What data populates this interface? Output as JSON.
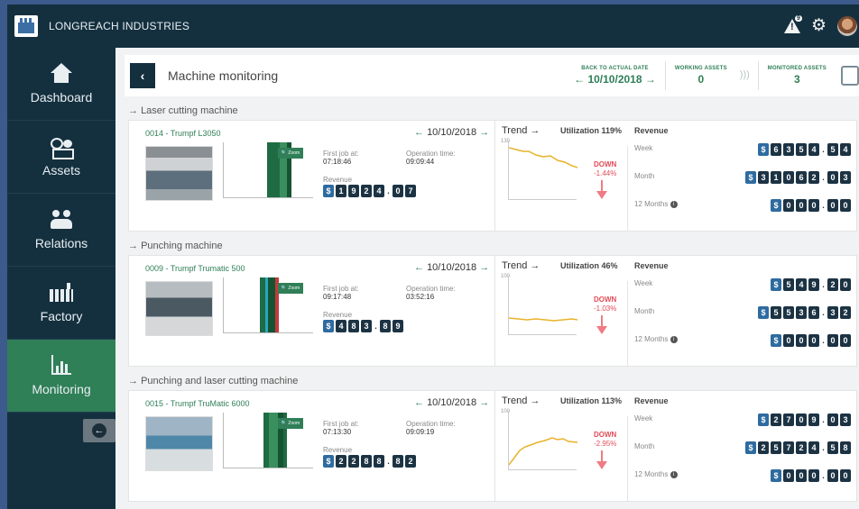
{
  "app": {
    "company": "LONGREACH INDUSTRIES",
    "alert_count": "9"
  },
  "sidebar": {
    "items": [
      {
        "label": "Dashboard",
        "icon": "home-icon"
      },
      {
        "label": "Assets",
        "icon": "assets-icon"
      },
      {
        "label": "Relations",
        "icon": "relations-icon"
      },
      {
        "label": "Factory",
        "icon": "factory-icon"
      },
      {
        "label": "Monitoring",
        "icon": "chart-icon",
        "active": true
      }
    ],
    "collapse_icon": "arrow-left-icon"
  },
  "header": {
    "title": "Machine monitoring",
    "back_to_date_label": "BACK TO ACTUAL DATE",
    "date": "10/10/2018",
    "working_assets_label": "WORKING ASSETS",
    "working_assets": "0",
    "monitored_assets_label": "MONITORED ASSETS",
    "monitored_assets": "3"
  },
  "machines": [
    {
      "section": "Laser cutting machine",
      "name": "0014 - Trumpf L3050",
      "date": "10/10/2018",
      "first_job_label": "First job at:",
      "first_job": "07:18:46",
      "op_time_label": "Operation time:",
      "op_time": "09:09:44",
      "revenue_label": "Revenue",
      "revenue_digits": [
        "$",
        "1",
        "9",
        "2",
        "4",
        ".",
        "0",
        "7"
      ],
      "trend_label": "Trend",
      "trend_ymax": "130",
      "utilization_label": "Utilization 119%",
      "direction": "DOWN",
      "change": "-1.44%",
      "revenue_header": "Revenue",
      "week_label": "Week",
      "week_digits": [
        "$",
        "6",
        "3",
        "5",
        "4",
        ".",
        "5",
        "4"
      ],
      "month_label": "Month",
      "month_digits": [
        "$",
        "3",
        "1",
        "0",
        "6",
        "2",
        ".",
        "0",
        "3"
      ],
      "months12_label": "12 Months",
      "months12_digits": [
        "$",
        "0",
        "0",
        "0",
        ".",
        "0",
        "0"
      ]
    },
    {
      "section": "Punching machine",
      "name": "0009 - Trumpf Trumatic 500",
      "date": "10/10/2018",
      "first_job_label": "First job at:",
      "first_job": "09:17:48",
      "op_time_label": "Operation time:",
      "op_time": "03:52:16",
      "revenue_label": "Revenue",
      "revenue_digits": [
        "$",
        "4",
        "8",
        "3",
        ".",
        "8",
        "9"
      ],
      "trend_label": "Trend",
      "trend_ymax": "100",
      "utilization_label": "Utilization  46%",
      "direction": "DOWN",
      "change": "-1.03%",
      "revenue_header": "Revenue",
      "week_label": "Week",
      "week_digits": [
        "$",
        "5",
        "4",
        "9",
        ".",
        "2",
        "0"
      ],
      "month_label": "Month",
      "month_digits": [
        "$",
        "5",
        "5",
        "3",
        "6",
        ".",
        "3",
        "2"
      ],
      "months12_label": "12 Months",
      "months12_digits": [
        "$",
        "0",
        "0",
        "0",
        ".",
        "0",
        "0"
      ]
    },
    {
      "section": "Punching and laser cutting machine",
      "name": "0015 - Trumpf TruMatic 6000",
      "date": "10/10/2018",
      "first_job_label": "First job at:",
      "first_job": "07:13:30",
      "op_time_label": "Operation time:",
      "op_time": "09:09:19",
      "revenue_label": "Revenue",
      "revenue_digits": [
        "$",
        "2",
        "2",
        "8",
        "8",
        ".",
        "8",
        "2"
      ],
      "trend_label": "Trend",
      "trend_ymax": "100",
      "utilization_label": "Utilization 113%",
      "direction": "DOWN",
      "change": "-2.95%",
      "revenue_header": "Revenue",
      "week_label": "Week",
      "week_digits": [
        "$",
        "2",
        "7",
        "0",
        "9",
        ".",
        "0",
        "3"
      ],
      "month_label": "Month",
      "month_digits": [
        "$",
        "2",
        "5",
        "7",
        "2",
        "4",
        ".",
        "5",
        "8"
      ],
      "months12_label": "12 Months",
      "months12_digits": [
        "$",
        "0",
        "0",
        "0",
        ".",
        "0",
        "0"
      ]
    }
  ],
  "zoom_label": "Zoom",
  "colors": {
    "accent": "#2f7f57",
    "navy": "#14303f",
    "down": "#e24c58"
  }
}
